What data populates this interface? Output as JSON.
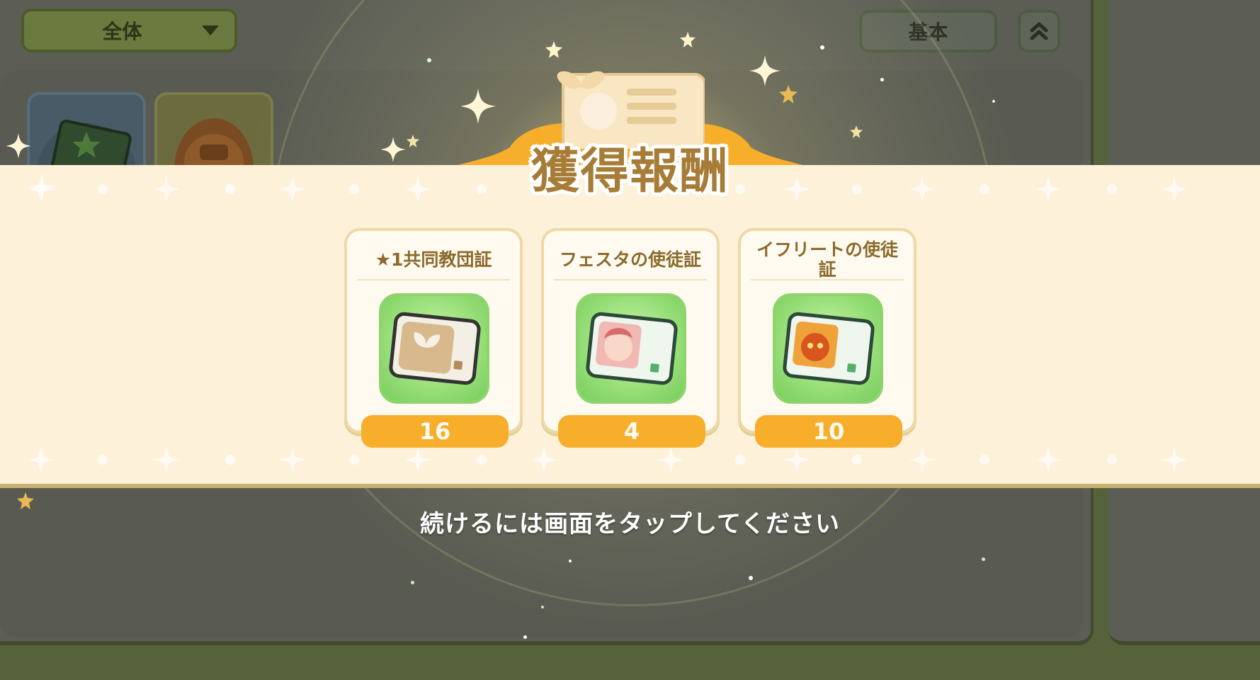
{
  "toolbar": {
    "filter_label": "全体",
    "sort_label": "基本"
  },
  "reward_popup": {
    "title": "獲得報酬",
    "items": [
      {
        "name": "★1共同教団証",
        "quantity": "16",
        "icon": "sprout-card-icon"
      },
      {
        "name": "フェスタの使徒証",
        "quantity": "4",
        "icon": "festa-apostle-card-icon"
      },
      {
        "name": "イフリートの使徒証",
        "quantity": "10",
        "icon": "ifrit-apostle-card-icon"
      }
    ],
    "continue_hint": "続けるには画面をタップしてください"
  },
  "colors": {
    "banner_bg": "#fdf1d9",
    "title_text": "#a77c36",
    "quantity_badge": "#f6ae2b",
    "icon_frame": "#97de78"
  }
}
